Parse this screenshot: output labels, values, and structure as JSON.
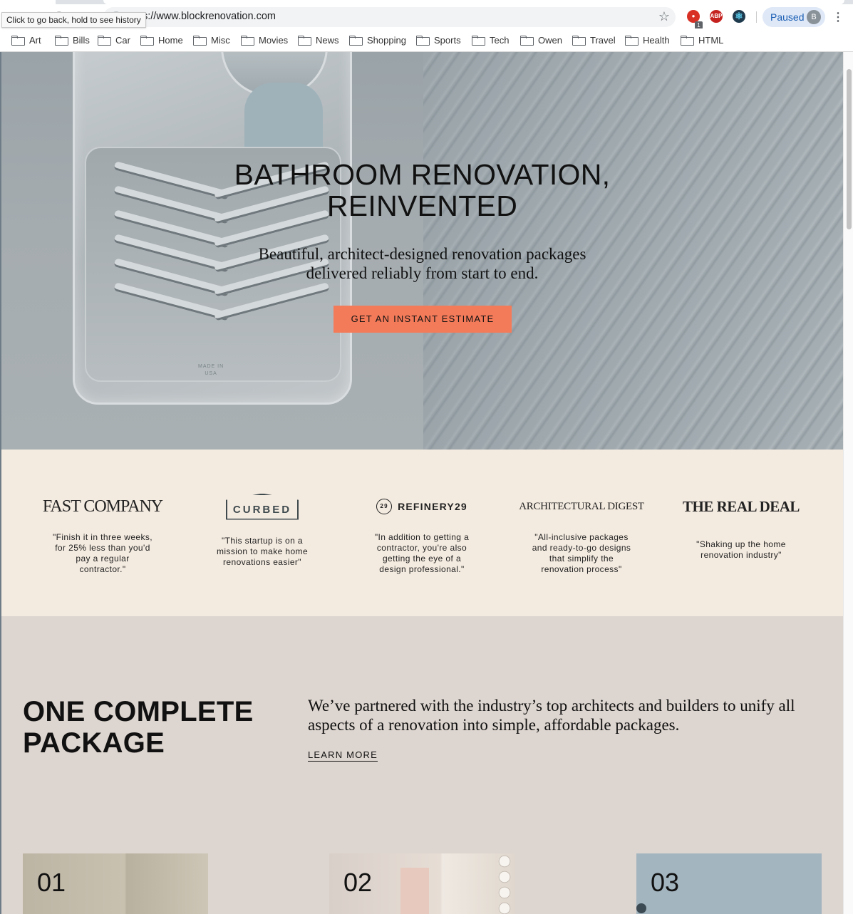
{
  "browser": {
    "url": "https://www.blockrenovation.com",
    "url_visible": "s://www.blockrenovation.com",
    "tooltip": "Click to go back, hold to see history",
    "extension_badge": "1",
    "extension_abp": "ABP",
    "profile_label": "Paused",
    "profile_initial": "B",
    "bookmarks": [
      "Art",
      "Bills",
      "Car",
      "Home",
      "Misc",
      "Movies",
      "News",
      "Shopping",
      "Sports",
      "Tech",
      "Owen",
      "Travel",
      "Health",
      "HTML"
    ]
  },
  "hero": {
    "title_line1": "BATHROOM RENOVATION,",
    "title_line2": "REINVENTED",
    "subtitle_line1": "Beautiful, architect-designed renovation packages",
    "subtitle_line2": "delivered reliably from start to end.",
    "cta_label": "GET AN INSTANT ESTIMATE",
    "tray_stamp_line1": "MADE IN",
    "tray_stamp_line2": "USA",
    "cta_color": "#f47b5a"
  },
  "press": [
    {
      "logo": "FAST COMPANY",
      "quote": "\"Finish it in three weeks, for 25% less than you'd pay a regular contractor.\""
    },
    {
      "logo": "CURBED",
      "quote": "\"This startup is on a mission to make home renovations easier\""
    },
    {
      "logo": "REFINERY29",
      "logo_mark": "29",
      "quote": "\"In addition to getting a contractor, you're also getting the eye of a design professional.\""
    },
    {
      "logo": "ARCHITECTURAL DIGEST",
      "quote": "\"All-inclusive packages and ready-to-go designs that simplify the renovation process\""
    },
    {
      "logo": "THE REAL DEAL",
      "quote": "\"Shaking up the home renovation industry\""
    }
  ],
  "package": {
    "title_line1": "ONE COMPLETE",
    "title_line2": "PACKAGE",
    "description": "We’ve partnered with the industry’s top architects and builders to unify all aspects of a renovation into simple, affordable packages.",
    "learn_more": "LEARN MORE",
    "cards": [
      "01",
      "02",
      "03"
    ]
  },
  "colors": {
    "press_bg": "#f4ebe0",
    "package_bg": "#ddd5cf",
    "profile_text": "#1a5fb4"
  }
}
